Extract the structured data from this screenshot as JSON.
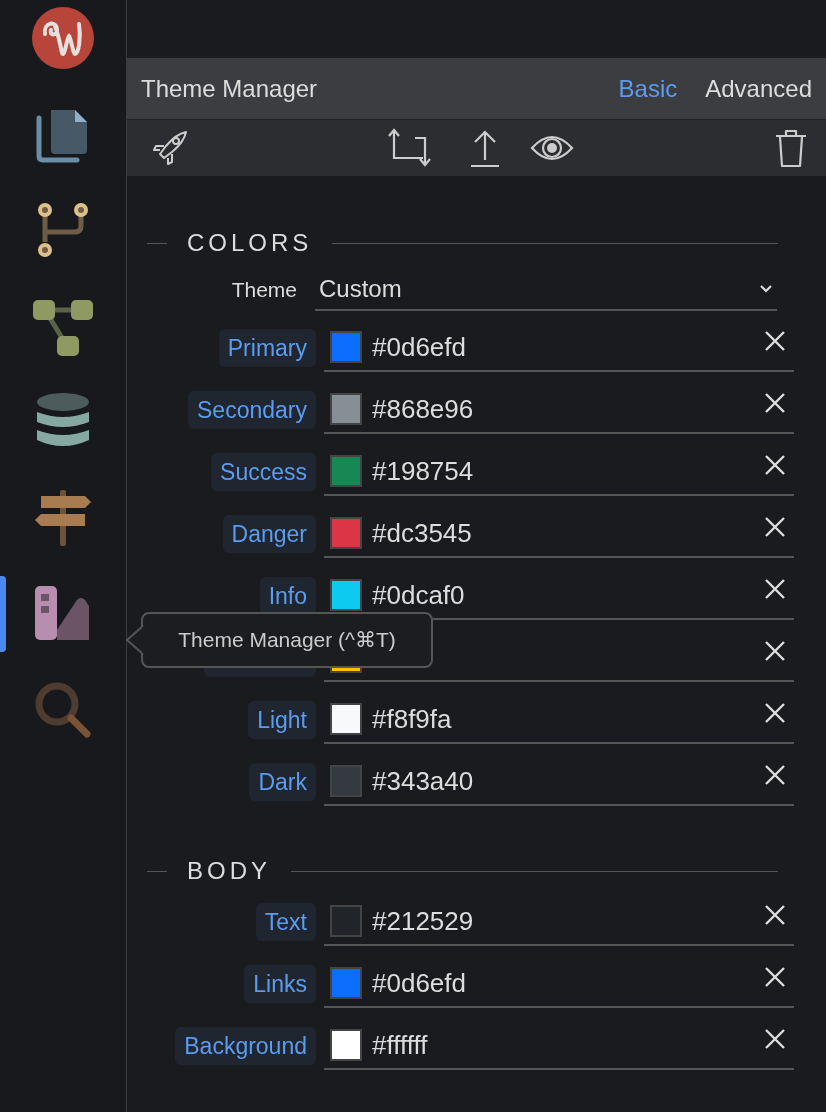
{
  "sidebar": {
    "items": [
      {
        "kind": "logo",
        "selected": false
      },
      {
        "kind": "pages",
        "selected": false
      },
      {
        "kind": "branches",
        "selected": false
      },
      {
        "kind": "nodes",
        "selected": false
      },
      {
        "kind": "database",
        "selected": false
      },
      {
        "kind": "signpost",
        "selected": false
      },
      {
        "kind": "palette",
        "selected": true
      },
      {
        "kind": "search",
        "selected": false
      }
    ]
  },
  "tooltip": "Theme Manager (^⌘T)",
  "panel": {
    "title": "Theme Manager",
    "tabs": [
      {
        "label": "Basic",
        "selected": true
      },
      {
        "label": "Advanced",
        "selected": false
      }
    ],
    "sections": [
      {
        "title": "COLORS",
        "theme": {
          "label": "Theme",
          "value": "Custom"
        },
        "rows": [
          {
            "label": "Primary",
            "color": "#0d6efd",
            "value": "#0d6efd"
          },
          {
            "label": "Secondary",
            "color": "#868e96",
            "value": "#868e96"
          },
          {
            "label": "Success",
            "color": "#198754",
            "value": "#198754"
          },
          {
            "label": "Danger",
            "color": "#dc3545",
            "value": "#dc3545"
          },
          {
            "label": "Info",
            "color": "#0dcaf0",
            "value": "#0dcaf0"
          },
          {
            "color": "#ffc107"
          },
          {
            "label": "Light",
            "color": "#f8f9fa",
            "value": "#f8f9fa"
          },
          {
            "label": "Dark",
            "color": "#343a40",
            "value": "#343a40"
          }
        ]
      },
      {
        "title": "BODY",
        "rows": [
          {
            "label": "Text",
            "color": "#212529",
            "value": "#212529"
          },
          {
            "label": "Links",
            "color": "#0d6efd",
            "value": "#0d6efd"
          },
          {
            "label": "Background",
            "color": "#ffffff",
            "value": "#ffffff"
          }
        ]
      }
    ]
  }
}
